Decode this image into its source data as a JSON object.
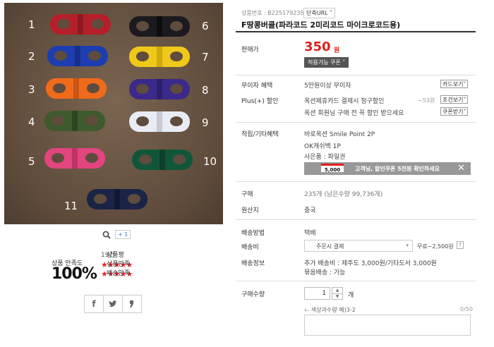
{
  "gallery": {
    "numbers": [
      "1",
      "2",
      "3",
      "4",
      "5",
      "6",
      "7",
      "8",
      "9",
      "10",
      "11"
    ],
    "colors": {
      "c1": "#b3202a",
      "c2": "#1d3db0",
      "c3": "#f06a1c",
      "c4": "#3f5a2c",
      "c5": "#e3457f",
      "c6": "#1b1b1f",
      "c7": "#f0c81a",
      "c8": "#3b2a8a",
      "c9": "#e9ecf5",
      "c10": "#12563a",
      "c11": "#1b2446"
    },
    "zoom_icon": "magnifier-icon",
    "plus_count": "+ 1"
  },
  "satisfaction": {
    "title": "상품 만족도",
    "percent": "100%",
    "review_label": "상품평",
    "review_count": "19건",
    "product_label": "상품만족",
    "delivery_label": "배송만족",
    "product_stars": 5,
    "delivery_stars": 5,
    "star_glyphs": "★★★★★"
  },
  "share": {
    "facebook": "f",
    "twitter": "t",
    "other": ""
  },
  "product": {
    "number_label": "상품번호 : B225179235",
    "short_url": "단축URL",
    "title": "F땅콩버클(파라코드 2미리코드 마이크로코드용)",
    "price_label": "판매가",
    "price": "350",
    "price_unit": "원",
    "coupon_button": "적용가능 쿠폰"
  },
  "benefits": {
    "interest_label": "무이자 혜택",
    "interest_value": "5만원이상 무이자",
    "card_button": "카드보기",
    "plus_label": "Plus(+) 할인",
    "plus_value": "옥션제휴카드 결제시 청구할인",
    "plus_amount": "~53원",
    "condition_button": "조건보기",
    "member_value": "옥션 회원님 구매 전 꼭 할인 받으세요",
    "coupon_button": "쿠폰받기"
  },
  "points": {
    "label": "적립/기타혜택",
    "line1": "바로옥션 Smile Point 2P",
    "line2": "OK캐쉬백 1P",
    "line3": "사은품 : 파일권",
    "banner_tag": "5,000",
    "banner_text": "고객님, 할인쿠폰 5천원 확인하세요",
    "banner_close": "✕"
  },
  "stock": {
    "sold_label": "구매",
    "sold_value": "235개 (남은수량 99,736개)",
    "origin_label": "원산지",
    "origin_value": "중국"
  },
  "shipping": {
    "method_label": "배송방법",
    "method_value": "택배",
    "fee_label": "배송비",
    "fee_select": "주문시 결제",
    "fee_range": "무료~2,500원",
    "help": "?",
    "info_label": "배송정보",
    "info_line1": "추가 배송비 : 제주도 3,000원/기타도서 3,000원",
    "info_line2": "묶음배송 : 가능"
  },
  "order": {
    "qty_label": "구매수량",
    "qty_value": "1",
    "qty_unit": "개",
    "hint": "ㄴ 색상과수량 예)3-2",
    "counter": "0/50"
  }
}
